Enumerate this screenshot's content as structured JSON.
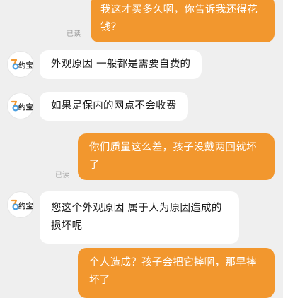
{
  "theme": {
    "outgoing_bg": "#f2972e",
    "incoming_bg": "#ffffff",
    "page_bg": "#efefef"
  },
  "brand": {
    "avatar_label": "约宝",
    "avatar_icon": "yuebao-logo-icon"
  },
  "messages": [
    {
      "direction": "out",
      "text": "我这才买多久啊，你告诉我还得花钱？",
      "status": "已读"
    },
    {
      "direction": "in",
      "text": "外观原因 一般都是需要自费的"
    },
    {
      "direction": "in",
      "text": "如果是保内的网点不会收费"
    },
    {
      "direction": "out",
      "text": "你们质量这么差，孩子没戴两回就坏了",
      "status": "已读"
    },
    {
      "direction": "in",
      "text": "您这个外观原因 属于人为原因造成的损坏呢"
    },
    {
      "direction": "out",
      "text": "个人造成？孩子会把它摔啊，那早摔坏了"
    }
  ]
}
